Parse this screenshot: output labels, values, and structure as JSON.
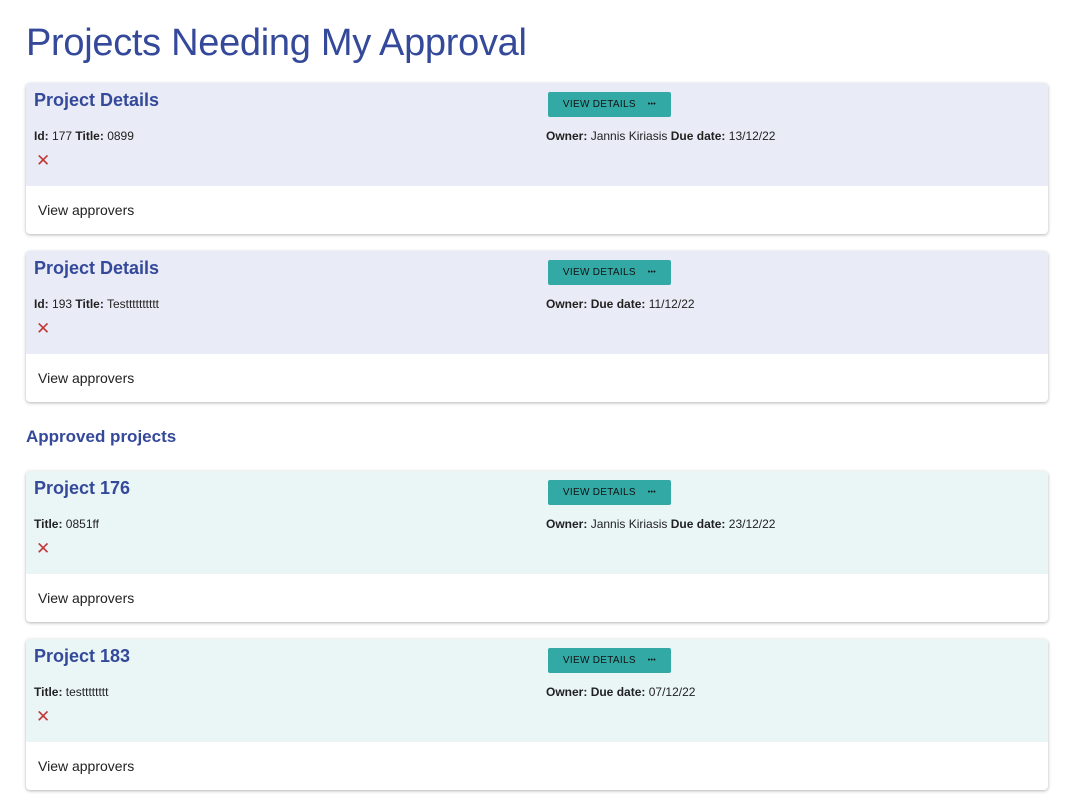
{
  "page_title": "Projects Needing My Approval",
  "approved_heading": "Approved projects",
  "labels": {
    "id": "Id:",
    "title": "Title:",
    "owner": "Owner:",
    "due": "Due date:",
    "view_details": "VIEW DETAILS",
    "more": "•••",
    "view_approvers": "View approvers",
    "remove": "✕"
  },
  "pending": [
    {
      "heading": "Project Details",
      "id": "177",
      "title": "0899",
      "owner": "Jannis Kiriasis",
      "due": "13/12/22"
    },
    {
      "heading": "Project Details",
      "id": "193",
      "title": "Testttttttttt",
      "owner": "",
      "due": "11/12/22"
    }
  ],
  "approved": [
    {
      "heading": "Project 176",
      "title": "0851ff",
      "owner": "Jannis Kiriasis",
      "due": "23/12/22"
    },
    {
      "heading": "Project 183",
      "title": "testttttttt",
      "owner": "",
      "due": "07/12/22"
    }
  ],
  "colors": {
    "accent": "#34499a",
    "button": "#33a9a6",
    "pending_bg": "#e9ebf6",
    "approved_bg": "#eaf6f6",
    "remove": "#c0393b"
  }
}
